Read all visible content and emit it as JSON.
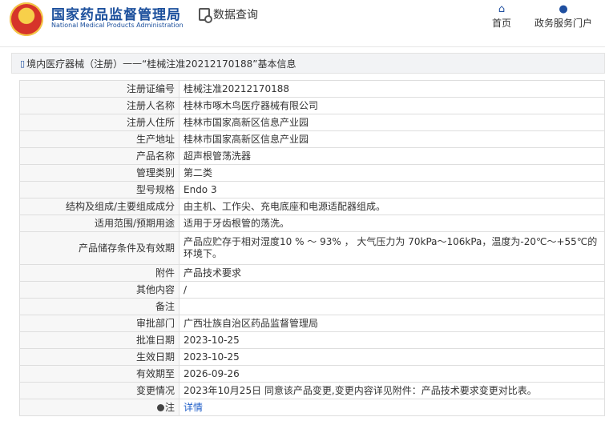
{
  "header": {
    "org_cn": "国家药品监督管理局",
    "org_en": "National Medical Products Administration",
    "query_label": "数据查询",
    "nav_home": "首页",
    "nav_service": "政务服务门户"
  },
  "breadcrumb": {
    "category": "境内医疗器械（注册）",
    "sep": "——",
    "title": "“桂械注准20212170188”基本信息"
  },
  "table": {
    "rows": [
      {
        "k": "注册证编号",
        "v": "桂械注准20212170188"
      },
      {
        "k": "注册人名称",
        "v": "桂林市啄木鸟医疗器械有限公司"
      },
      {
        "k": "注册人住所",
        "v": "桂林市国家高新区信息产业园"
      },
      {
        "k": "生产地址",
        "v": "桂林市国家高新区信息产业园"
      },
      {
        "k": "产品名称",
        "v": "超声根管荡洗器"
      },
      {
        "k": "管理类别",
        "v": "第二类"
      },
      {
        "k": "型号规格",
        "v": "Endo 3"
      },
      {
        "k": "结构及组成/主要组成成分",
        "v": "由主机、工作尖、充电底座和电源适配器组成。"
      },
      {
        "k": "适用范围/预期用途",
        "v": "适用于牙齿根管的荡洗。"
      },
      {
        "k": "产品储存条件及有效期",
        "v": "产品应贮存于相对湿度10 % ～ 93% ， 大气压力为 70kPa～106kPa，温度为-20℃～+55℃的环境下。"
      },
      {
        "k": "附件",
        "v": "产品技术要求"
      },
      {
        "k": "其他内容",
        "v": "/"
      },
      {
        "k": "备注",
        "v": ""
      },
      {
        "k": "审批部门",
        "v": "广西壮族自治区药品监督管理局"
      },
      {
        "k": "批准日期",
        "v": "2023-10-25"
      },
      {
        "k": "生效日期",
        "v": "2023-10-25"
      },
      {
        "k": "有效期至",
        "v": "2026-09-26"
      },
      {
        "k": "变更情况",
        "v": "2023年10月25日 同意该产品变更,变更内容详见附件：产品技术要求变更对比表。"
      }
    ],
    "note_label": "注",
    "note_link": "详情"
  }
}
